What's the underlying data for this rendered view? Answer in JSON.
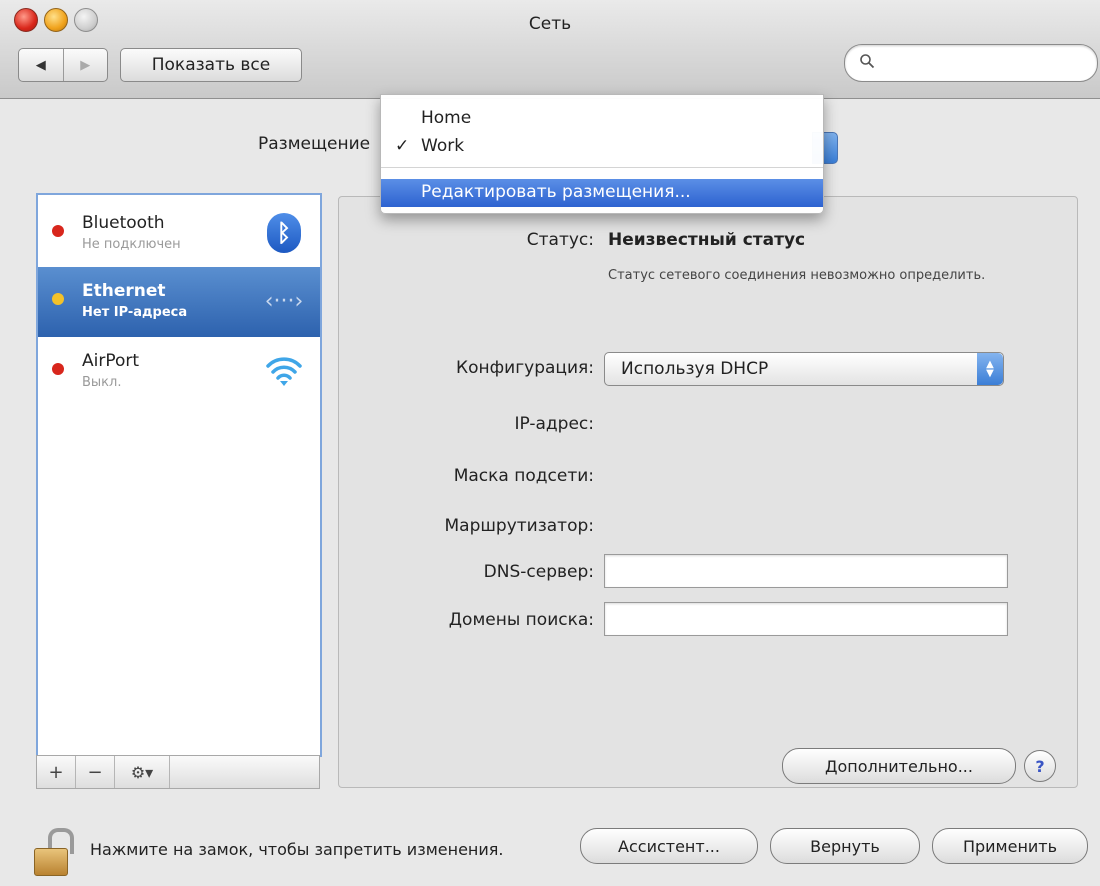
{
  "window": {
    "title": "Сеть"
  },
  "toolbar": {
    "back": "◀",
    "forward": "▶",
    "show_all": "Показать все",
    "search_placeholder": ""
  },
  "location": {
    "label": "Размещение",
    "menu": [
      {
        "label": "Home",
        "checked": false
      },
      {
        "label": "Work",
        "checked": true
      },
      {
        "label": "Редактировать размещения...",
        "highlighted": true
      }
    ],
    "check_mark": "✓"
  },
  "services": [
    {
      "name": "Bluetooth",
      "status": "Не подключен",
      "status_color": "#d8261c",
      "icon": "bluetooth-icon",
      "icon_glyph": "ᛒ"
    },
    {
      "name": "Ethernet",
      "status": "Нет IP-адреса",
      "status_color": "#f3c22a",
      "icon": "ethernet-icon",
      "icon_glyph": "‹···›",
      "selected": true
    },
    {
      "name": "AirPort",
      "status": "Выкл.",
      "status_color": "#d8261c",
      "icon": "wifi-icon"
    }
  ],
  "sidebar_controls": {
    "add": "+",
    "remove": "−",
    "gear": "⚙▾"
  },
  "detail": {
    "status_label": "Статус:",
    "status_value": "Неизвестный статус",
    "status_description": "Статус сетевого соединения невозможно определить.",
    "config_label": "Конфигурация:",
    "config_value": "Используя DHCP",
    "ip_label": "IP-адрес:",
    "mask_label": "Маска подсети:",
    "router_label": "Маршрутизатор:",
    "dns_label": "DNS-сервер:",
    "dns_value": "",
    "search_domains_label": "Домены поиска:",
    "search_domains_value": "",
    "advanced": "Дополнительно...",
    "help": "?"
  },
  "footer": {
    "lock_message": "Нажмите на замок, чтобы запретить изменения.",
    "assistant": "Ассистент...",
    "revert": "Вернуть",
    "apply": "Применить"
  },
  "colors": {
    "accent": "#2d62ae",
    "menu_highlight": "#3a6fd8"
  }
}
